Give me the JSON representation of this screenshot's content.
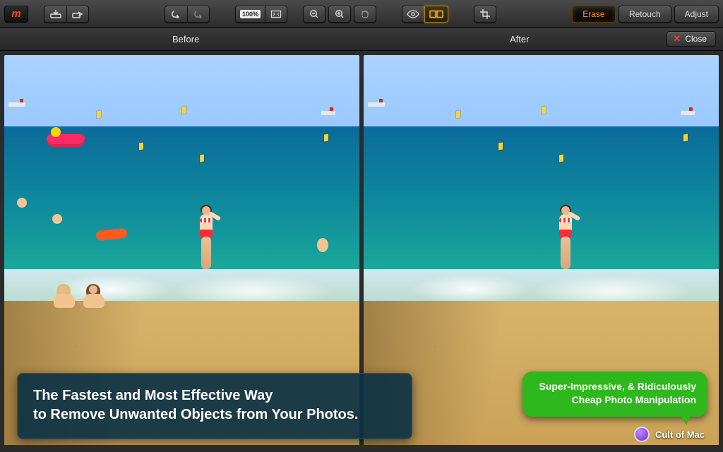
{
  "app": {
    "logo_text": "m"
  },
  "toolbar": {
    "zoom_label": "100%",
    "modes": {
      "erase": "Erase",
      "retouch": "Retouch",
      "adjust": "Adjust"
    },
    "active_mode": "erase",
    "compare_view": "side-by-side"
  },
  "labels": {
    "before": "Before",
    "after": "After",
    "close": "Close"
  },
  "promo": {
    "headline_line1": "The Fastest and Most Effective Way",
    "headline_line2": "to Remove Unwanted Objects from Your Photos."
  },
  "quote": {
    "text_line1": "Super-Impressive, & Ridiculously",
    "text_line2": "Cheap Photo Manipulation",
    "source": "Cult of Mac"
  },
  "scene": {
    "before_extras": [
      "pedal-boat",
      "orange-float",
      "sitting-women",
      "swimmers",
      "far-swimmer"
    ],
    "subject": "woman-red-bikini",
    "setting": "beach-sea-sky"
  }
}
